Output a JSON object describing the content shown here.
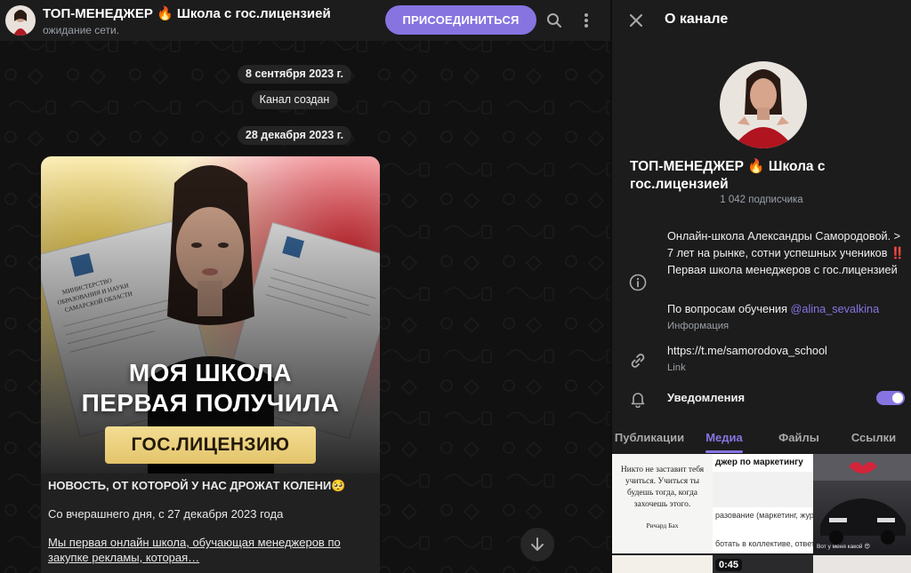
{
  "chat": {
    "title": "ТОП-МЕНЕДЖЕР 🔥 Школа с гос.лицензией",
    "status": "ожидание сети.",
    "join_label": "ПРИСОЕДИНИТЬСЯ",
    "date1": "8 сентября 2023 г.",
    "service_msg": "Канал создан",
    "date2": "28 декабря 2023 г.",
    "image_headline1": "МОЯ ШКОЛА",
    "image_headline2": "ПЕРВАЯ ПОЛУЧИЛА",
    "image_license": "ГОС.ЛИЦЕНЗИЮ",
    "doc_text": "МИНИСТЕРСТВО ОБРАЗОВАНИЯ И НАУКИ САМАРСКОЙ ОБЛАСТИ",
    "message_line1": "НОВОСТЬ, ОТ КОТОРОЙ У НАС ДРОЖАТ КОЛЕНИ🥺",
    "message_line2": "Со вчерашнего дня, с 27 декабря 2023 года",
    "message_line3": "Мы первая онлайн школа, обучающая менеджеров по закупке рекламы, которая…"
  },
  "info": {
    "header_title": "О канале",
    "channel_name": "ТОП-МЕНЕДЖЕР 🔥 Школа с гос.лицензией",
    "subscribers": "1 042 подписчика",
    "description": "Онлайн-школа Александры Самородовой. > 7 лет на рынке, сотни успешных учеников ‼️Первая школа менеджеров с гос.лицензией",
    "contact_prefix": "По вопросам обучения ",
    "contact_mention": "@alina_sevalkina",
    "info_label": "Информация",
    "link": "https://t.me/samorodova_school",
    "link_label": "Link",
    "notifications_label": "Уведомления",
    "notifications_on": true,
    "tabs": [
      {
        "label": "Публикации",
        "active": false
      },
      {
        "label": "Медиа",
        "active": true
      },
      {
        "label": "Файлы",
        "active": false
      },
      {
        "label": "Ссылки",
        "active": false
      }
    ],
    "media": {
      "quote_text": "Никто не заставит тебя учиться. Учиться ты будешь тогда, когда захочешь этого.",
      "quote_author": "Ричард Бах",
      "course_header": "джер по маркетингу",
      "course_line1": "разование (маркетинг, журн",
      "course_line2": "ботать в коллективе, ответств",
      "car_caption": "Вот у меня какой 😍",
      "duration": "0:45"
    }
  },
  "colors": {
    "accent": "#8774e1",
    "chat_bg": "#111111",
    "panel_bg": "#1c1c1d"
  }
}
